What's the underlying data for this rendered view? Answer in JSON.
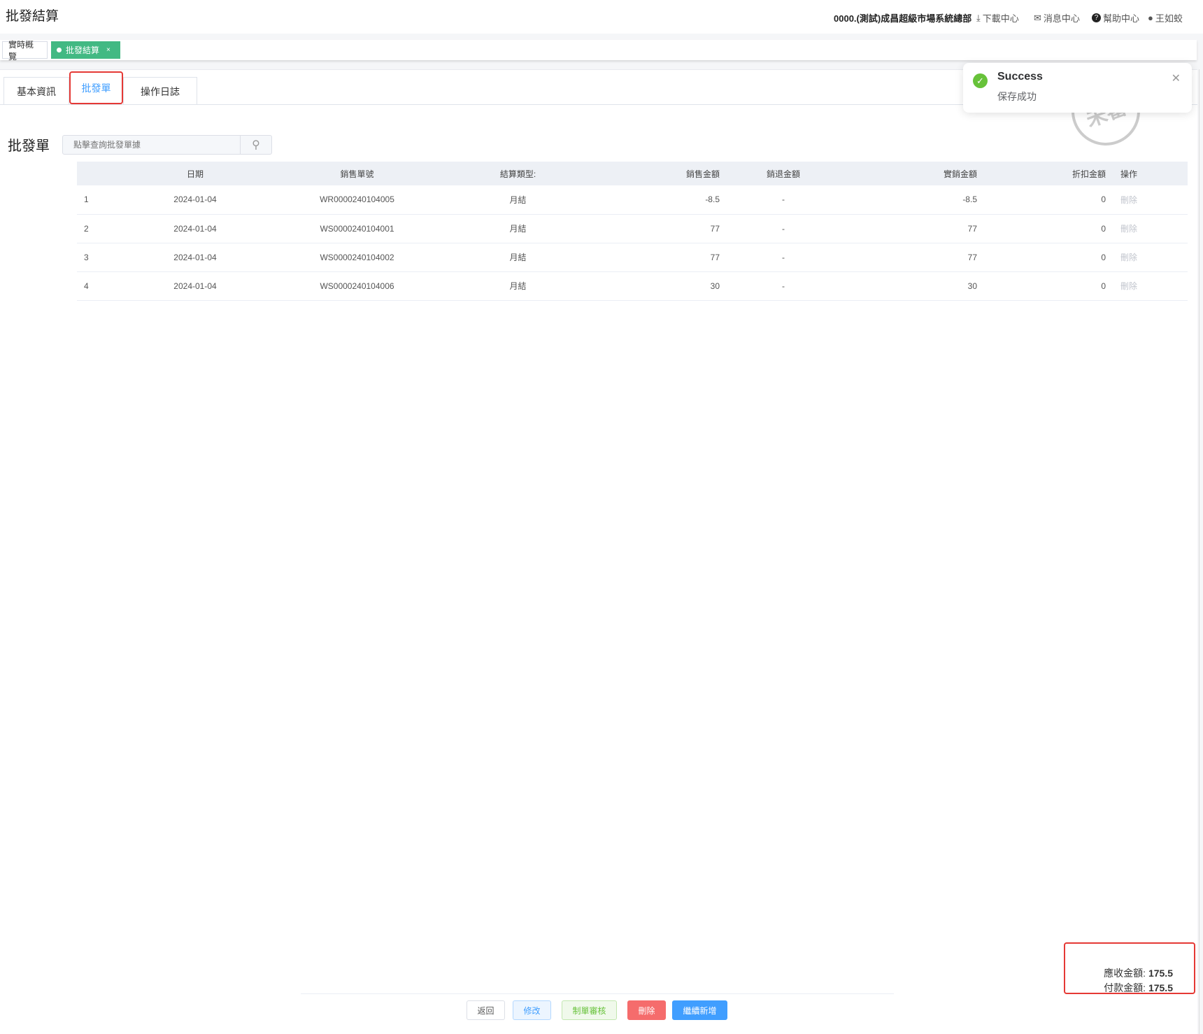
{
  "header": {
    "title": "批發結算",
    "org": "0000.(測試)成昌超級市場系統總部",
    "download": "下載中心",
    "messages": "消息中心",
    "help": "幫助中心",
    "user": "王如蛟"
  },
  "tags": [
    {
      "label": "實時概覽"
    },
    {
      "label": "批發結算",
      "close": "×"
    }
  ],
  "tabs": [
    {
      "label": "基本資訊"
    },
    {
      "label": "批發單"
    },
    {
      "label": "操作日誌"
    }
  ],
  "section": {
    "title": "批發單",
    "search_placeholder": "點擊查詢批發單據"
  },
  "table": {
    "columns": [
      "",
      "日期",
      "銷售單號",
      "結算類型:",
      "銷售金額",
      "銷退金額",
      "實銷金額",
      "折扣金額",
      "操作"
    ],
    "rows": [
      {
        "no": "1",
        "date": "2024-01-04",
        "order": "WR0000240104005",
        "type": "月結",
        "sales": "-8.5",
        "returns": "-",
        "net": "-8.5",
        "discount": "0",
        "action": "刪除"
      },
      {
        "no": "2",
        "date": "2024-01-04",
        "order": "WS0000240104001",
        "type": "月結",
        "sales": "77",
        "returns": "-",
        "net": "77",
        "discount": "0",
        "action": "刪除"
      },
      {
        "no": "3",
        "date": "2024-01-04",
        "order": "WS0000240104002",
        "type": "月結",
        "sales": "77",
        "returns": "-",
        "net": "77",
        "discount": "0",
        "action": "刪除"
      },
      {
        "no": "4",
        "date": "2024-01-04",
        "order": "WS0000240104006",
        "type": "月結",
        "sales": "30",
        "returns": "-",
        "net": "30",
        "discount": "0",
        "action": "刪除"
      }
    ]
  },
  "toast": {
    "title": "Success",
    "message": "保存成功"
  },
  "stamp": {
    "text": "未審"
  },
  "totals": {
    "receivable_label": "應收金額:",
    "receivable": "175.5",
    "payment_label": "付款金額:",
    "payment": "175.5"
  },
  "buttons": {
    "back": "返回",
    "edit": "修改",
    "audit": "制單審核",
    "delete": "刪除",
    "continue_add": "繼續新增"
  },
  "colors": {
    "primary": "#409eff",
    "success": "#67c23a",
    "danger": "#f56c6c",
    "tag_active": "#42b983",
    "highlight": "#e53935"
  }
}
